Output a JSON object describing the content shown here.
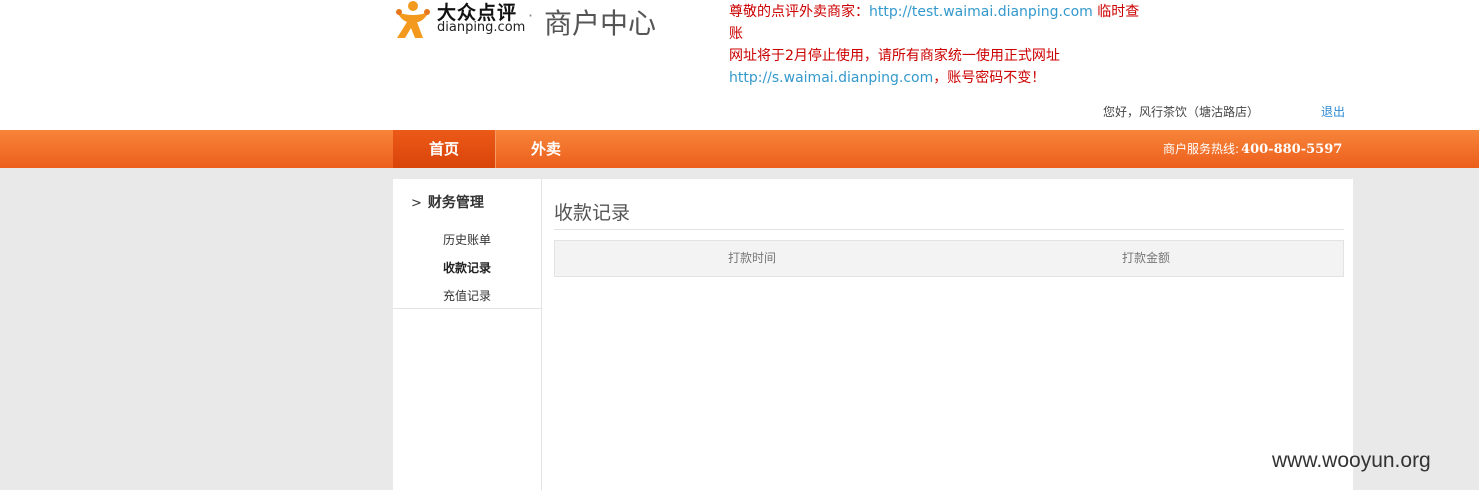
{
  "header": {
    "logo_cn": "大众点评",
    "logo_en": "dianping.com",
    "title": "商户中心",
    "notice": {
      "line1_prefix": "尊敬的点评外卖商家：",
      "line1_url": "http://test.waimai.dianping.com",
      "line1_suffix": " 临时查账",
      "line2": "网址将于2月停止使用，请所有商家统一使用正式网址",
      "line3_url": "http://s.waimai.dianping.com",
      "line3_suffix": "，账号密码不变！"
    },
    "greeting": "您好，风行茶饮（塘沽路店）",
    "logout_label": "退出"
  },
  "nav": {
    "items": [
      {
        "label": "首页",
        "active": true
      },
      {
        "label": "外卖",
        "active": false
      }
    ],
    "hotline_label": "商户服务热线:",
    "hotline_number": "400-880-5597"
  },
  "sidebar": {
    "section_title": "财务管理",
    "links": [
      {
        "label": "历史账单",
        "active": false
      },
      {
        "label": "收款记录",
        "active": true
      },
      {
        "label": "充值记录",
        "active": false
      }
    ]
  },
  "main": {
    "title": "收款记录",
    "columns": [
      "打款时间",
      "打款金额"
    ]
  },
  "watermark": "www.wooyun.org",
  "colors": {
    "nav_orange": "#ec5f1c",
    "notice_red": "#cc0000",
    "link_blue": "#3399cc"
  }
}
